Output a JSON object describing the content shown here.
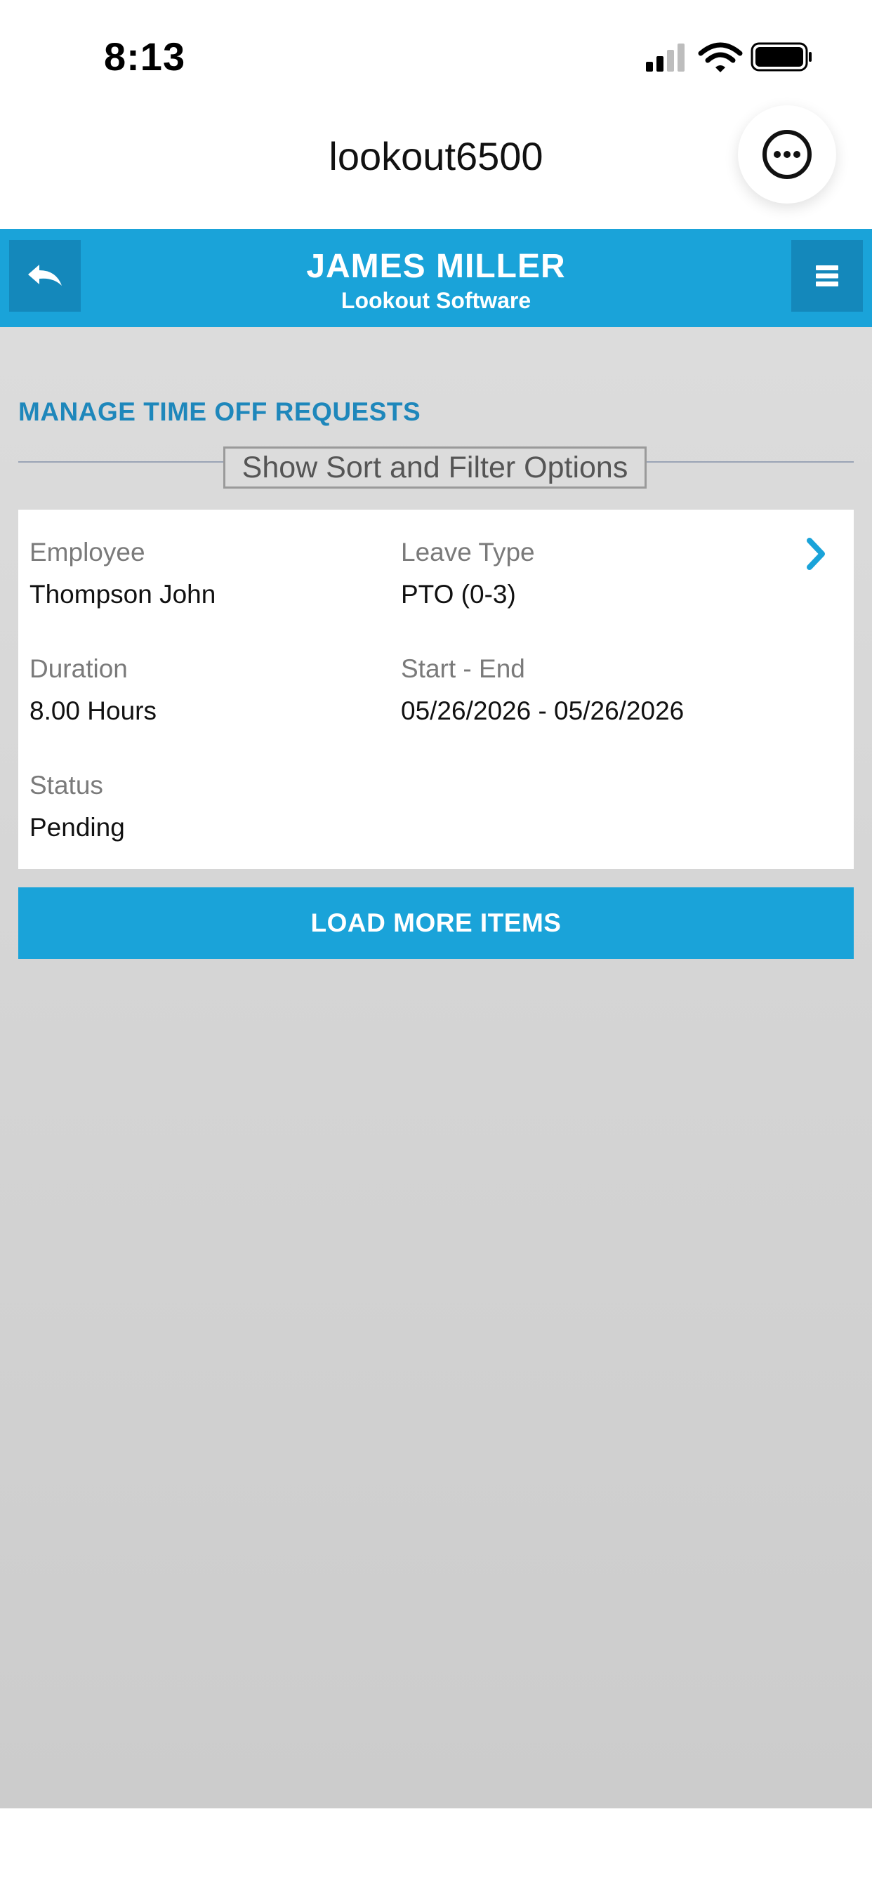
{
  "status_bar": {
    "time": "8:13",
    "icons": [
      "signal-icon",
      "wifi-icon",
      "battery-icon"
    ]
  },
  "browser": {
    "title": "lookout6500",
    "more_icon": "more-options-icon"
  },
  "header": {
    "title": "JAMES MILLER",
    "subtitle": "Lookout Software",
    "back_icon": "back-arrow-icon",
    "menu_icon": "hamburger-menu-icon",
    "color": "#1aa3d9"
  },
  "main": {
    "section_title": "MANAGE TIME OFF REQUESTS",
    "filter_label": "Show Sort and Filter Options",
    "requests": [
      {
        "employee_label": "Employee",
        "employee": "Thompson John",
        "leave_type_label": "Leave Type",
        "leave_type": "PTO (0-3)",
        "duration_label": "Duration",
        "duration": "8.00 Hours",
        "start_end_label": "Start - End",
        "start_end": "05/26/2026 - 05/26/2026",
        "status_label": "Status",
        "status": "Pending"
      }
    ],
    "load_more_label": "LOAD MORE ITEMS"
  }
}
